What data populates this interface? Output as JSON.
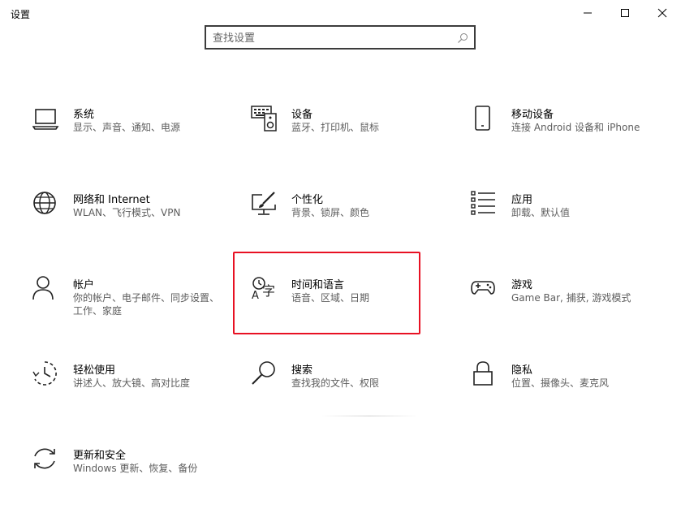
{
  "window": {
    "title": "设置",
    "minimize_icon": "minimize-icon",
    "maximize_icon": "maximize-icon",
    "close_icon": "close-icon"
  },
  "search": {
    "placeholder": "查找设置",
    "value": "",
    "icon": "search-icon"
  },
  "tiles": [
    {
      "title": "系统",
      "description": "显示、声音、通知、电源",
      "icon": "laptop-icon"
    },
    {
      "title": "设备",
      "description": "蓝牙、打印机、鼠标",
      "icon": "keyboard-speaker-icon"
    },
    {
      "title": "移动设备",
      "description": "连接 Android 设备和 iPhone",
      "icon": "phone-icon"
    },
    {
      "title": "网络和 Internet",
      "description": "WLAN、飞行模式、VPN",
      "icon": "globe-icon"
    },
    {
      "title": "个性化",
      "description": "背景、锁屏、颜色",
      "icon": "paint-brush-icon"
    },
    {
      "title": "应用",
      "description": "卸载、默认值",
      "icon": "apps-list-icon"
    },
    {
      "title": "帐户",
      "description": "你的帐户、电子邮件、同步设置、工作、家庭",
      "icon": "person-icon"
    },
    {
      "title": "时间和语言",
      "description": "语音、区域、日期",
      "icon": "time-language-icon"
    },
    {
      "title": "游戏",
      "description": "Game Bar, 捕获, 游戏模式",
      "icon": "gamepad-icon"
    },
    {
      "title": "轻松使用",
      "description": "讲述人、放大镜、高对比度",
      "icon": "ease-of-access-icon"
    },
    {
      "title": "搜索",
      "description": "查找我的文件、权限",
      "icon": "magnifier-icon"
    },
    {
      "title": "隐私",
      "description": "位置、摄像头、麦克风",
      "icon": "lock-icon"
    },
    {
      "title": "更新和安全",
      "description": "Windows 更新、恢复、备份",
      "icon": "update-sync-icon"
    }
  ],
  "colors": {
    "highlight_border": "#e81123",
    "description_text": "#5d5d5d"
  }
}
